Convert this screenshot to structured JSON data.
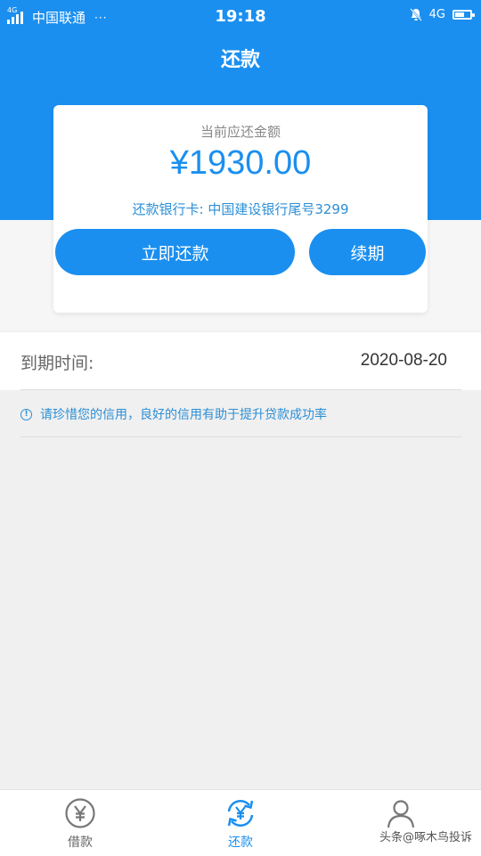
{
  "status_bar": {
    "network_label": "4G",
    "carrier": "中国联通",
    "more": "···",
    "time": "19:18",
    "mute_icon": "bell-mute-icon",
    "network_type": "4G",
    "battery_icon": "battery-icon",
    "battery_level": 0.55
  },
  "header": {
    "title": "还款"
  },
  "card": {
    "label": "当前应还金额",
    "amount": "¥1930.00",
    "bank_info": "还款银行卡: 中国建设银行尾号3299",
    "repay_button": "立即还款",
    "renew_button": "续期"
  },
  "due": {
    "label": "到期时间:",
    "value": "2020-08-20"
  },
  "notice": {
    "icon": "info-icon",
    "text": "请珍惜您的信用，良好的信用有助于提升贷款成功率"
  },
  "bottom_nav": {
    "items": [
      {
        "label": "借款",
        "icon": "yen-coin-icon",
        "active": false
      },
      {
        "label": "还款",
        "icon": "yen-refresh-icon",
        "active": true
      },
      {
        "label": "",
        "icon": "user-icon",
        "active": false
      }
    ]
  },
  "watermark": "头条@啄木鸟投诉",
  "colors": {
    "primary": "#1a8ff0",
    "text_link": "#2b8fd6",
    "background": "#f0f0f0"
  }
}
